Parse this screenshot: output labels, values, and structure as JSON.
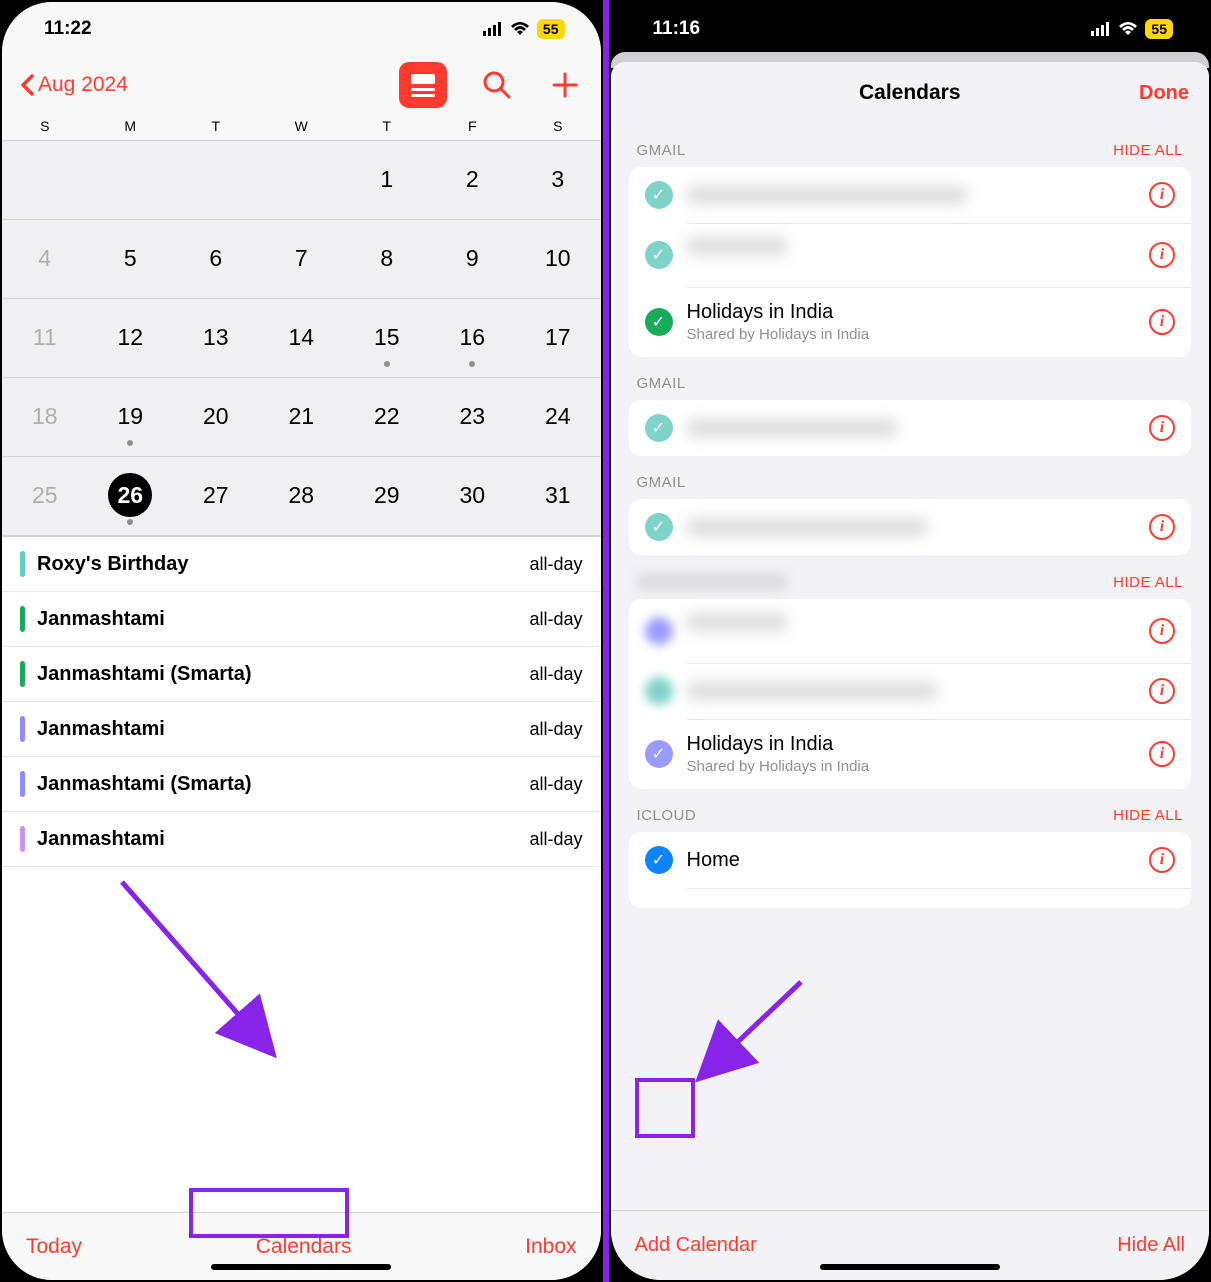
{
  "left": {
    "status": {
      "time": "11:22",
      "battery": "55"
    },
    "header": {
      "month": "Aug 2024"
    },
    "weekdays": [
      "S",
      "M",
      "T",
      "W",
      "T",
      "F",
      "S"
    ],
    "toolbar": {
      "today": "Today",
      "calendars": "Calendars",
      "inbox": "Inbox"
    },
    "events": [
      {
        "title": "Roxy's Birthday",
        "time": "all-day",
        "color": "#5ed0c0"
      },
      {
        "title": "Janmashtami",
        "time": "all-day",
        "color": "#1aab5a"
      },
      {
        "title": "Janmashtami (Smarta)",
        "time": "all-day",
        "color": "#1aab5a"
      },
      {
        "title": "Janmashtami",
        "time": "all-day",
        "color": "#8c8cff"
      },
      {
        "title": "Janmashtami (Smarta)",
        "time": "all-day",
        "color": "#8c8cff"
      },
      {
        "title": "Janmashtami",
        "time": "all-day",
        "color": "#c893e8"
      }
    ]
  },
  "right": {
    "status": {
      "time": "11:16",
      "battery": "55"
    },
    "sheet": {
      "title": "Calendars",
      "done": "Done"
    },
    "footer": {
      "add": "Add Calendar",
      "hide": "Hide All"
    },
    "hide_all": "HIDE ALL",
    "sections": {
      "gmail1": {
        "label": "GMAIL"
      },
      "gmail2": {
        "label": "GMAIL"
      },
      "gmail3": {
        "label": "GMAIL"
      },
      "icloud": {
        "label": "ICLOUD"
      }
    },
    "holidays": {
      "name": "Holidays in India",
      "sub": "Shared by Holidays in India"
    },
    "home": {
      "name": "Home"
    }
  },
  "grid": {
    "r1": [
      "",
      "",
      "",
      "",
      "1",
      "2",
      "3"
    ],
    "r2": [
      "4",
      "5",
      "6",
      "7",
      "8",
      "9",
      "10"
    ],
    "r3": [
      "11",
      "12",
      "13",
      "14",
      "15",
      "16",
      "17"
    ],
    "r4": [
      "18",
      "19",
      "20",
      "21",
      "22",
      "23",
      "24"
    ],
    "r5": [
      "25",
      "26",
      "27",
      "28",
      "29",
      "30",
      "31"
    ]
  }
}
